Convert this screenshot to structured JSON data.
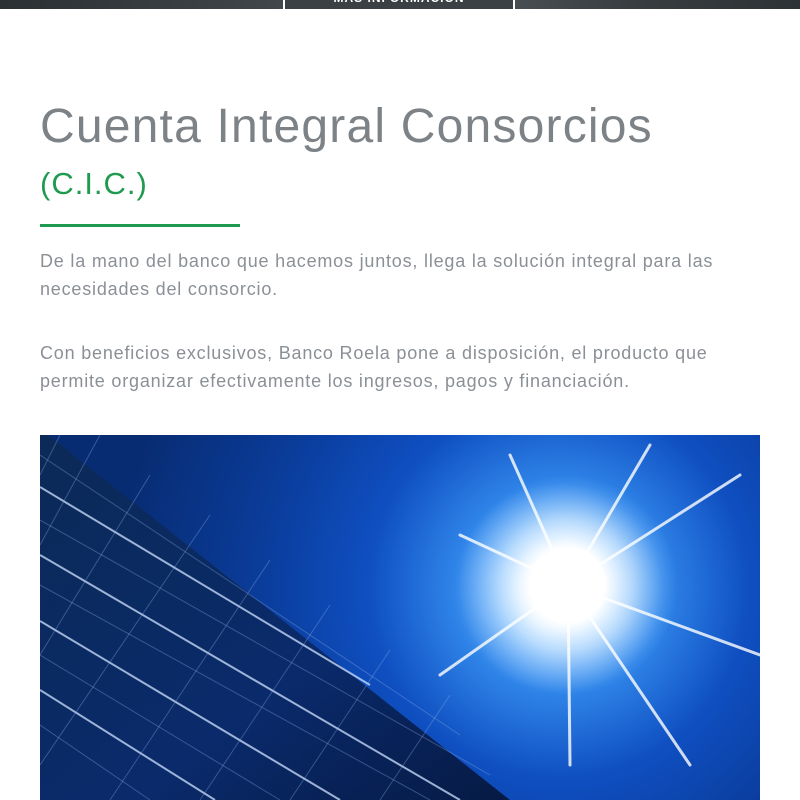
{
  "banner": {
    "more_info_label": "MÁS INFORMACIÓN"
  },
  "header": {
    "title": "Cuenta Integral Consorcios",
    "subtitle": "(C.I.C.)"
  },
  "body": {
    "paragraph_1": "De la mano del banco que hacemos juntos, llega la solución integral para las necesidades del consorcio.",
    "paragraph_2": "Con beneficios exclusivos, Banco Roela pone a disposición, el producto que permite organizar efectivamente los ingresos, pagos y financiación."
  },
  "hero_image": {
    "subject": "solar-panels-under-bright-sun"
  },
  "colors": {
    "accent": "#1e9b4f",
    "title": "#7d8287",
    "body_text": "#8b9096",
    "banner": "#3a4043"
  }
}
